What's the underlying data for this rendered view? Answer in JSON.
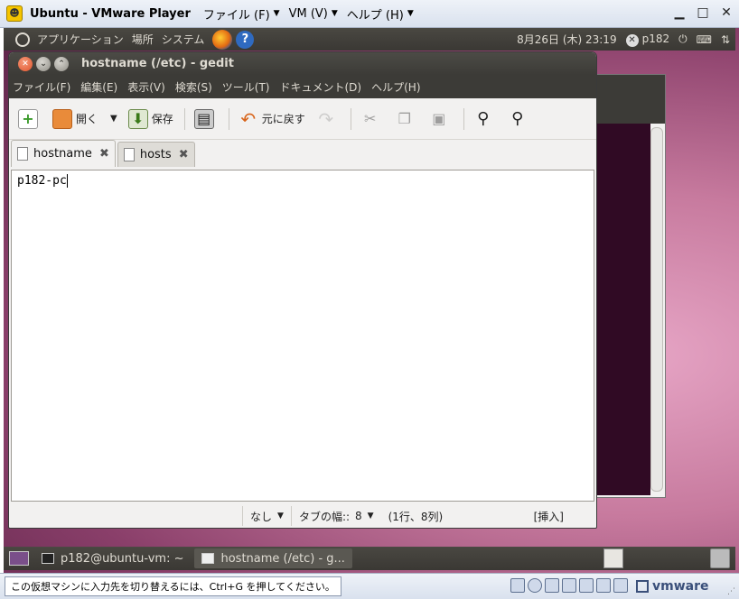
{
  "vm": {
    "title": "Ubuntu - VMware Player",
    "menus": [
      {
        "label": "ファイル (F)"
      },
      {
        "label": "VM (V)"
      },
      {
        "label": "ヘルプ (H)"
      }
    ],
    "status_hint": "この仮想マシンに入力先を切り替えるには、Ctrl+G を押してください。",
    "brand": "vmware"
  },
  "top_panel": {
    "menus": [
      "アプリケーション",
      "場所",
      "システム"
    ],
    "clock": "8月26日 (木) 23:19",
    "user": "p182"
  },
  "gedit": {
    "title": "hostname (/etc) - gedit",
    "menubar": [
      "ファイル(F)",
      "編集(E)",
      "表示(V)",
      "検索(S)",
      "ツール(T)",
      "ドキュメント(D)",
      "ヘルプ(H)"
    ],
    "toolbar": {
      "open": "開く",
      "save": "保存",
      "undo": "元に戻す"
    },
    "tabs": [
      {
        "label": "hostname",
        "active": true
      },
      {
        "label": "hosts",
        "active": false
      }
    ],
    "content": "p182-pc",
    "status": {
      "highlight": "なし",
      "tab_width_label": "タブの幅::",
      "tab_width": "8",
      "position": "(1行、8列)",
      "mode": "[挿入]"
    }
  },
  "bottom_panel": {
    "tasks": [
      {
        "label": "p182@ubuntu-vm: ~"
      },
      {
        "label": "hostname (/etc) - g..."
      }
    ]
  },
  "colors": {
    "panel": "#3c3b37",
    "desktop": "#c77a9e",
    "close_button": "#e0532b"
  }
}
